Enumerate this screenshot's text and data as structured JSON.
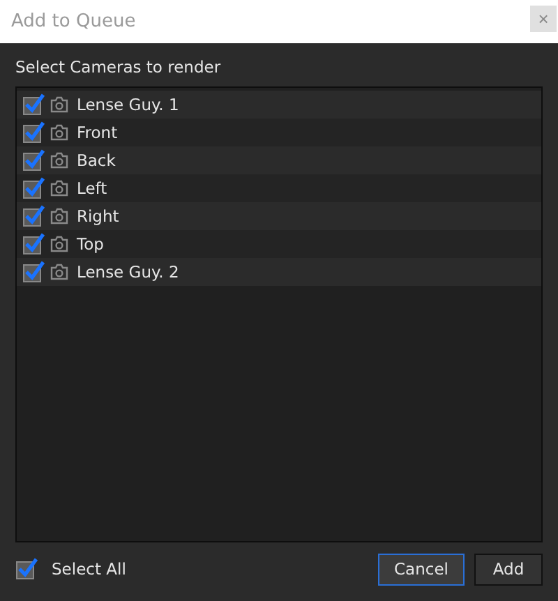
{
  "window": {
    "title": "Add to Queue",
    "close": "×"
  },
  "prompt": "Select Cameras to render",
  "cameras": [
    {
      "name": "Lense Guy. 1",
      "checked": true
    },
    {
      "name": "Front",
      "checked": true
    },
    {
      "name": "Back",
      "checked": true
    },
    {
      "name": "Left",
      "checked": true
    },
    {
      "name": "Right",
      "checked": true
    },
    {
      "name": "Top",
      "checked": true
    },
    {
      "name": "Lense Guy. 2",
      "checked": true
    }
  ],
  "select_all": {
    "label": "Select All",
    "checked": true
  },
  "buttons": [
    {
      "label": "Cancel",
      "focused": true
    },
    {
      "label": "Add",
      "focused": false
    }
  ]
}
